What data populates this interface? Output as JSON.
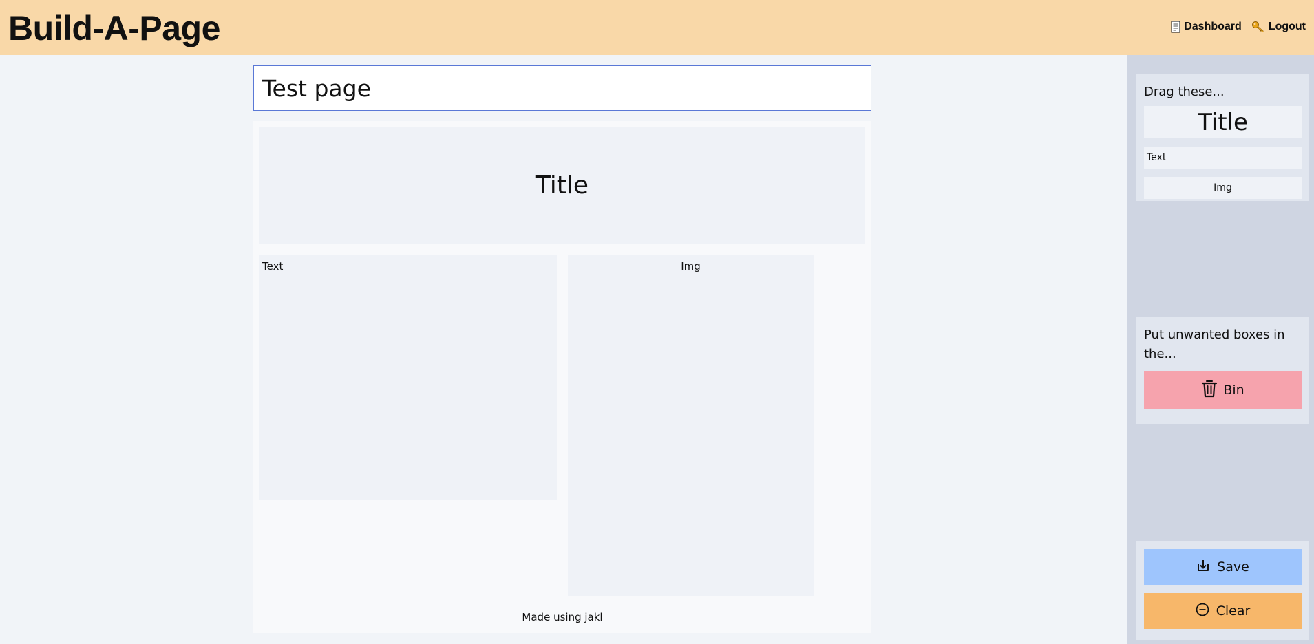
{
  "header": {
    "app_title": "Build-A-Page",
    "nav": [
      {
        "label": "Dashboard",
        "icon": "document-icon"
      },
      {
        "label": "Logout",
        "icon": "key-icon"
      }
    ]
  },
  "editor": {
    "page_title_value": "Test page",
    "blocks": {
      "title": "Title",
      "text": "Text",
      "img": "Img"
    },
    "footer_note": "Made using jakl"
  },
  "sidebar": {
    "drag_heading": "Drag these...",
    "drag_items": {
      "title": "Title",
      "text": "Text",
      "img": "Img"
    },
    "bin_heading": "Put unwanted boxes in the...",
    "bin_label": "Bin",
    "save_label": "Save",
    "clear_label": "Clear"
  },
  "colors": {
    "header_bg": "#f9d8a8",
    "bin_bg": "#f6a3ad",
    "save_bg": "#9ec5fd",
    "clear_bg": "#f7b76a",
    "sidebar_bg": "#cfd5e2"
  }
}
